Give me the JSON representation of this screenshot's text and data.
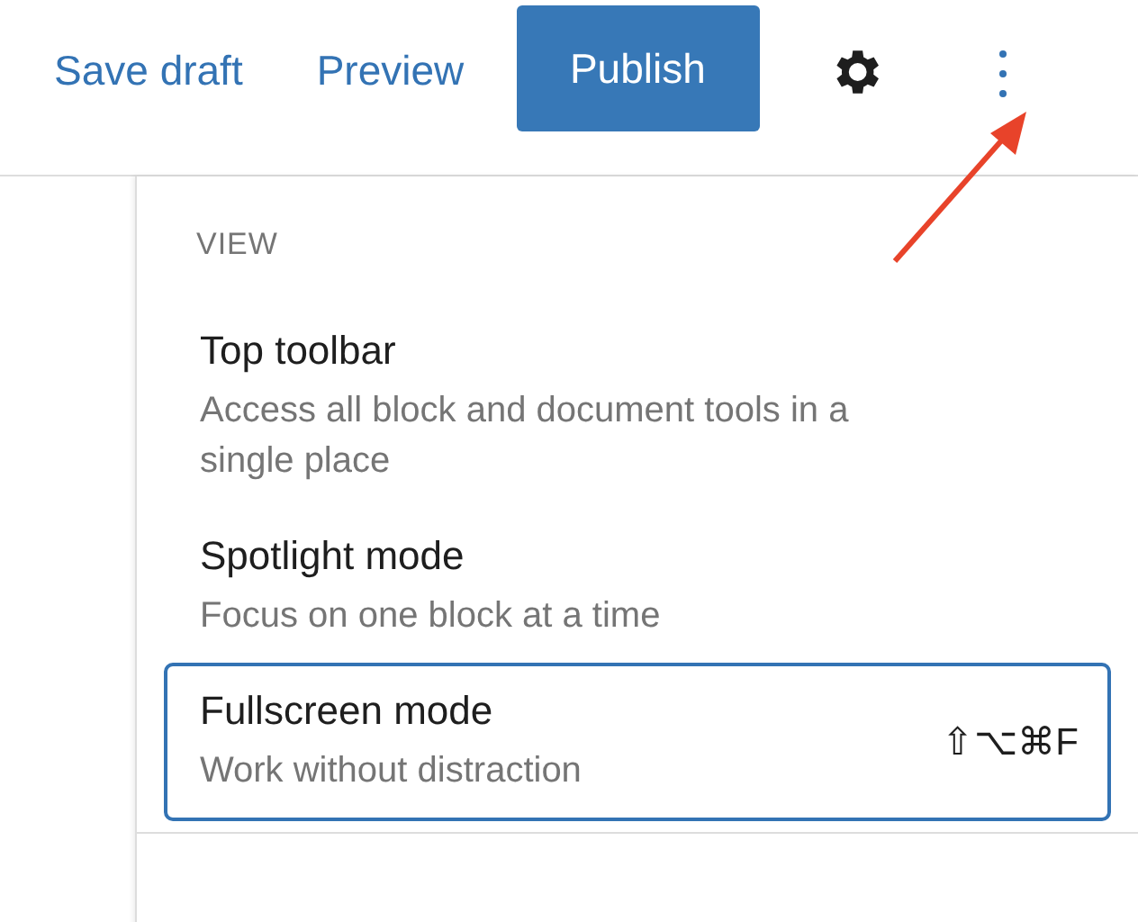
{
  "header": {
    "links": [
      "Save draft",
      "Preview"
    ],
    "publish": "Publish"
  },
  "menu": {
    "section": "VIEW",
    "items": [
      {
        "title": "Top toolbar",
        "description": "Access all block and document tools in a single place",
        "selected": false
      },
      {
        "title": "Spotlight mode",
        "description": "Focus on one block at a time",
        "selected": false
      },
      {
        "title": "Fullscreen mode",
        "description": "Work without distraction",
        "shortcut": "⇧⌥⌘F",
        "selected": true
      }
    ]
  }
}
